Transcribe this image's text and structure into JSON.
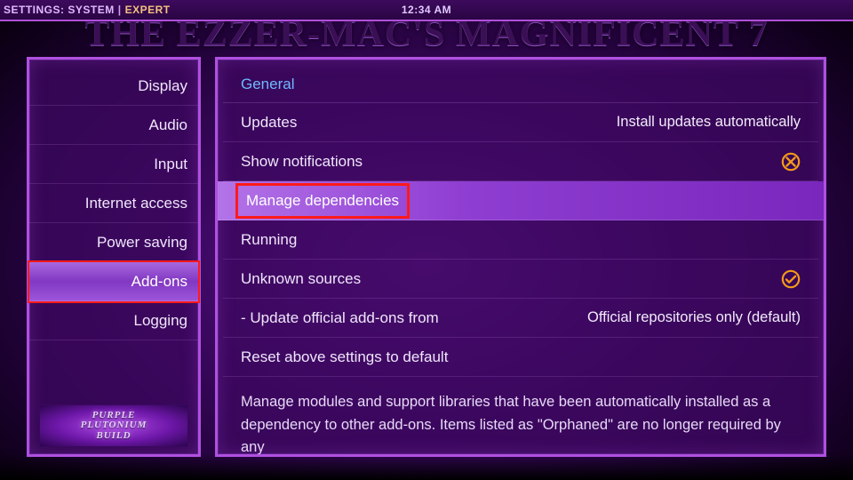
{
  "topbar": {
    "crumb1": "SETTINGS:",
    "crumb2": "SYSTEM",
    "mode": "EXPERT",
    "clock": "12:34 AM"
  },
  "bg_title": "THE EZZER-MAC'S MAGNIFICENT 7",
  "sidebar": {
    "items": [
      {
        "label": "Display"
      },
      {
        "label": "Audio"
      },
      {
        "label": "Input"
      },
      {
        "label": "Internet access"
      },
      {
        "label": "Power saving"
      },
      {
        "label": "Add-ons"
      },
      {
        "label": "Logging"
      }
    ],
    "logo_line1": "PURPLE",
    "logo_line2": "PLUTONIUM",
    "logo_line3": "BUILD"
  },
  "content": {
    "section": "General",
    "rows": {
      "updates_label": "Updates",
      "updates_value": "Install updates automatically",
      "show_notifications_label": "Show notifications",
      "manage_deps_label": "Manage dependencies",
      "running_label": "Running",
      "unknown_sources_label": "Unknown sources",
      "update_official_label": "- Update official add-ons from",
      "update_official_value": "Official repositories only (default)",
      "reset_label": "Reset above settings to default"
    },
    "description": "Manage modules and support libraries that have been automatically installed as a dependency to other add-ons. Items listed as \"Orphaned\" are no longer required by any"
  },
  "icons": {
    "toggle_off_name": "toggle-off-icon",
    "toggle_on_name": "toggle-on-icon"
  }
}
